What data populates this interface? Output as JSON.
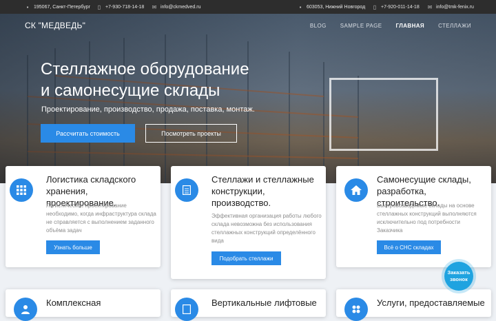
{
  "topbar": {
    "left": [
      {
        "icon": "map-marker-icon",
        "text": "195067, Санкт-Петербург"
      },
      {
        "icon": "phone-icon",
        "text": "+7-930-718-14-18"
      },
      {
        "icon": "mail-icon",
        "text": "info@ckmedved.ru"
      }
    ],
    "right": [
      {
        "icon": "map-marker-icon",
        "text": "603053, Нижний Новгород"
      },
      {
        "icon": "phone-icon",
        "text": "+7-920-011-14-18"
      },
      {
        "icon": "mail-icon",
        "text": "info@tmk-fenix.ru"
      }
    ]
  },
  "nav": {
    "logo": "СК \"МЕДВЕДЬ\"",
    "items": [
      "BLOG",
      "SAMPLE PAGE",
      "ГЛАВНАЯ",
      "СТЕЛЛАЖИ"
    ],
    "active": "ГЛАВНАЯ"
  },
  "hero": {
    "title_line1": "Стеллажное оборудование",
    "title_line2": "и самонесущие склады",
    "subtitle": "Проектирование, производство, продажа, поставка, монтаж.",
    "primary_button": "Рассчитать стоимость",
    "secondary_button": "Посмотреть проекты"
  },
  "cards": [
    {
      "icon": "grid-icon",
      "title": "Логистика складского хранения, проектирование.",
      "text": "Логистическое проектирование необходимо, когда инфраструктура склада не справляется с выполнением заданного объёма задач",
      "button": "Узнать больше"
    },
    {
      "icon": "document-icon",
      "title": "Стеллажи и стеллажные конструкции, производство.",
      "text": "Эффективная организация работы любого склада невозможна без использования стеллажных конструкций определённого вида",
      "button": "Подобрать стеллажи"
    },
    {
      "icon": "home-icon",
      "title": "Самонесущие склады, разработка, строительство.",
      "text": "Быстровозводимые склады на основе стеллажных конструкций выполняются исключительно под потребности Заказчика",
      "button": "Всё о СНС складах"
    }
  ],
  "cards_bottom": [
    {
      "icon": "user-icon",
      "title": "Комплексная"
    },
    {
      "icon": "document-icon",
      "title": "Вертикальные лифтовые"
    },
    {
      "icon": "dots-icon",
      "title": "Услуги, предоставляемые"
    }
  ],
  "callback": {
    "line1": "Заказать",
    "line2": "звонок"
  }
}
